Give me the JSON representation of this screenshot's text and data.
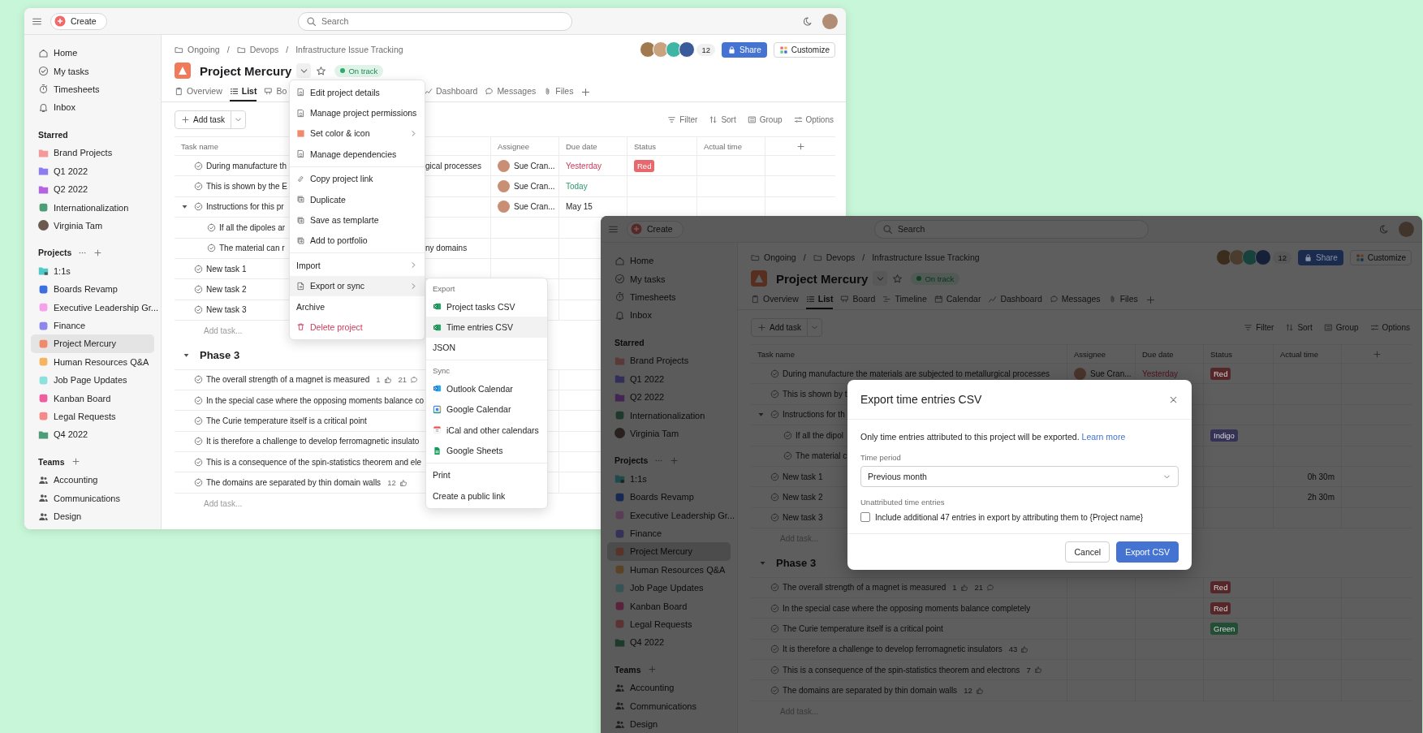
{
  "windows": [
    {
      "dimmed": false,
      "topbar": {
        "create": "Create",
        "search_placeholder": "Search"
      },
      "sidebar": {
        "nav": [
          {
            "label": "Home",
            "selected": false
          },
          {
            "label": "My tasks",
            "selected": false
          },
          {
            "label": "Timesheets",
            "selected": false
          },
          {
            "label": "Inbox",
            "selected": false
          }
        ],
        "sections": [
          {
            "title": "Starred",
            "items": [
              {
                "label": "Brand Projects",
                "kind": "folder",
                "color": "#f59a9a",
                "selected": false
              },
              {
                "label": "Q1 2022",
                "kind": "folder",
                "color": "#8b7cf0",
                "selected": false
              },
              {
                "label": "Q2 2022",
                "kind": "folder",
                "color": "#b563e0",
                "selected": false
              },
              {
                "label": "Internationalization",
                "kind": "project",
                "color": "#4e9d78",
                "selected": false
              },
              {
                "label": "Virginia Tam",
                "kind": "person",
                "selected": false
              }
            ]
          },
          {
            "title": "Projects",
            "more_button": true,
            "add_button": true,
            "items": [
              {
                "label": "1:1s",
                "kind": "locked-folder",
                "color": "#4fc9c9",
                "selected": false
              },
              {
                "label": "Boards Revamp",
                "kind": "project",
                "color": "#3d6fe0",
                "selected": false
              },
              {
                "label": "Executive Leadership Gr...",
                "kind": "project",
                "color": "#f5a3e8",
                "selected": false
              },
              {
                "label": "Finance",
                "kind": "project",
                "color": "#8e86ef",
                "selected": false
              },
              {
                "label": "Project Mercury",
                "kind": "project",
                "color": "#ef8a6a",
                "selected": true
              },
              {
                "label": "Human Resources Q&A",
                "kind": "project",
                "color": "#f4b460",
                "selected": false
              },
              {
                "label": "Job Page Updates",
                "kind": "project",
                "color": "#8de0de",
                "selected": false
              },
              {
                "label": "Kanban Board",
                "kind": "project",
                "color": "#ee5ea0",
                "selected": false
              },
              {
                "label": "Legal Requests",
                "kind": "project",
                "color": "#f58a8a",
                "selected": false
              },
              {
                "label": "Q4 2022",
                "kind": "folder",
                "color": "#4e9d78",
                "selected": false
              }
            ]
          },
          {
            "title": "Teams",
            "add_button": true,
            "items": [
              {
                "label": "Accounting",
                "kind": "team",
                "selected": false
              },
              {
                "label": "Communications",
                "kind": "team",
                "selected": false
              },
              {
                "label": "Design",
                "kind": "team",
                "selected": false
              }
            ]
          }
        ]
      },
      "breadcrumb": [
        {
          "label": "Ongoing",
          "kind": "folder"
        },
        {
          "label": "/",
          "kind": "separator"
        },
        {
          "label": "Devops",
          "kind": "folder"
        },
        {
          "label": "/",
          "kind": "separator"
        },
        {
          "label": "Infrastructure Issue Tracking",
          "kind": "page"
        }
      ],
      "project": {
        "name": "Project Mercury",
        "status": "On track",
        "members_count": "12",
        "share": "Share",
        "customize": "Customize"
      },
      "tabs": [
        {
          "label": "Overview",
          "kind": "overview",
          "selected": false
        },
        {
          "label": "List",
          "kind": "list",
          "selected": true
        },
        {
          "label": "Bo",
          "kind": "board",
          "selected": false
        }
      ],
      "tabs_after_menu": [
        {
          "label": "Dashboard",
          "kind": "dashboard",
          "selected": false
        },
        {
          "label": "Messages",
          "kind": "message",
          "selected": false
        },
        {
          "label": "Files",
          "kind": "clip",
          "selected": false
        }
      ],
      "add_task": "Add task",
      "toolbar": [
        {
          "label": "Filter",
          "kind": "filter"
        },
        {
          "label": "Sort",
          "kind": "sort"
        },
        {
          "label": "Group",
          "kind": "group"
        },
        {
          "label": "Options",
          "kind": "options"
        }
      ],
      "table": {
        "columns": [
          "Task name",
          "Assignee",
          "Due date",
          "Status",
          "Actual time"
        ],
        "rows": [
          {
            "name": "During manufacture th",
            "tail": "gical processes",
            "assignee": "Sue Cran...",
            "due": "Yesterday",
            "overdue": true,
            "status": {
              "label": "Red",
              "color": "#e8696d"
            }
          },
          {
            "name": "This is shown by the E",
            "assignee": "Sue Cran...",
            "due": "Today",
            "due_today": true
          },
          {
            "name": "Instructions for this pr",
            "assignee": "Sue Cran...",
            "due": "May 15",
            "expanded": true,
            "children": [
              {
                "name": "If all the dipoles ar"
              },
              {
                "name": "The material can r",
                "tail": "ny domains"
              }
            ]
          },
          {
            "name": "New task 1"
          },
          {
            "name": "New task 2"
          },
          {
            "name": "New task 3"
          }
        ],
        "add_task": "Add task...",
        "sections": [
          {
            "title": "Phase 3",
            "expanded": true,
            "rows": [
              {
                "name": "The overall strength of a magnet is measured",
                "likes": "1",
                "comments": "21"
              },
              {
                "name": "In the special case where the opposing moments balance co"
              },
              {
                "name": "The Curie temperature itself is a critical point"
              },
              {
                "name": "It is therefore a challenge to develop ferromagnetic insulato"
              },
              {
                "name": "This is a consequence of the spin-statistics theorem and ele"
              },
              {
                "name": "The domains are separated by thin domain walls",
                "likes": "12"
              }
            ],
            "add_task": "Add task..."
          }
        ]
      },
      "project_menu": {
        "sections": [
          {
            "items": [
              {
                "label": "Edit project details",
                "kind": "doc",
                "submenu": false,
                "selected": false
              },
              {
                "label": "Manage project permissions",
                "kind": "doc",
                "submenu": false,
                "selected": false
              },
              {
                "label": "Set color & icon",
                "kind": "swatch",
                "submenu": true,
                "selected": false
              },
              {
                "label": "Manage dependencies",
                "kind": "doc",
                "submenu": false,
                "selected": false
              }
            ]
          },
          {
            "items": [
              {
                "label": "Copy project link",
                "kind": "link",
                "submenu": false,
                "selected": false
              },
              {
                "label": "Duplicate",
                "kind": "copy",
                "submenu": false,
                "selected": false
              },
              {
                "label": "Save as templarte",
                "kind": "copy",
                "submenu": false,
                "selected": false
              },
              {
                "label": "Add to portfolio",
                "kind": "copy",
                "submenu": false,
                "selected": false
              }
            ]
          },
          {
            "items": [
              {
                "label": "Import",
                "kind": "plain",
                "submenu": true,
                "selected": false
              },
              {
                "label": "Export or sync",
                "kind": "export",
                "submenu": true,
                "selected": true
              },
              {
                "label": "Archive",
                "kind": "plain",
                "submenu": false,
                "selected": false
              },
              {
                "label": "Delete project",
                "kind": "delete",
                "submenu": false,
                "selected": false
              }
            ]
          }
        ]
      },
      "export_menu": {
        "sections": [
          {
            "heading": "Export",
            "items": [
              {
                "label": "Project tasks CSV",
                "kind": "excel",
                "selected": false
              },
              {
                "label": "Time entries CSV",
                "kind": "excel",
                "selected": true
              },
              {
                "label": "JSON",
                "kind": "plain",
                "selected": false
              }
            ]
          },
          {
            "heading": "Sync",
            "items": [
              {
                "label": "Outlook Calendar",
                "kind": "outlook",
                "selected": false
              },
              {
                "label": "Google Calendar",
                "kind": "gcal",
                "selected": false
              },
              {
                "label": "iCal and other calendars",
                "kind": "ical",
                "selected": false
              },
              {
                "label": "Google Sheets",
                "kind": "gsheets",
                "selected": false
              }
            ]
          },
          {
            "items": [
              {
                "label": "Print",
                "kind": "plain",
                "selected": false
              },
              {
                "label": "Create a public link",
                "kind": "plain",
                "selected": false
              }
            ]
          }
        ]
      }
    },
    {
      "dimmed": true,
      "topbar": {
        "create": "Create",
        "search_placeholder": "Search"
      },
      "sidebar": {
        "nav": [
          {
            "label": "Home",
            "selected": false
          },
          {
            "label": "My tasks",
            "selected": false
          },
          {
            "label": "Timesheets",
            "selected": false
          },
          {
            "label": "Inbox",
            "selected": false
          }
        ],
        "sections": [
          {
            "title": "Starred",
            "items": [
              {
                "label": "Brand Projects",
                "kind": "folder",
                "color": "#5b3939",
                "selected": false
              },
              {
                "label": "Q1 2022",
                "kind": "folder",
                "color": "#332e59",
                "selected": false
              },
              {
                "label": "Q2 2022",
                "kind": "folder",
                "color": "#432553",
                "selected": false
              },
              {
                "label": "Internationalization",
                "kind": "project",
                "color": "#1d3a2c",
                "selected": false
              },
              {
                "label": "Virginia Tam",
                "kind": "person",
                "selected": false
              }
            ]
          },
          {
            "title": "Projects",
            "more_button": true,
            "add_button": true,
            "items": [
              {
                "label": "1:1s",
                "kind": "locked-folder",
                "color": "#1d4a4a",
                "selected": false
              },
              {
                "label": "Boards Revamp",
                "kind": "project",
                "color": "#172953",
                "selected": false
              },
              {
                "label": "Executive Leadership Gr...",
                "kind": "project",
                "color": "#5b3c56",
                "selected": false
              },
              {
                "label": "Finance",
                "kind": "project",
                "color": "#353258",
                "selected": false
              },
              {
                "label": "Project Mercury",
                "kind": "project",
                "color": "#583327",
                "selected": true
              },
              {
                "label": "Human Resources Q&A",
                "kind": "project",
                "color": "#5a4324",
                "selected": false
              },
              {
                "label": "Job Page Updates",
                "kind": "project",
                "color": "#345352",
                "selected": false
              },
              {
                "label": "Kanban Board",
                "kind": "project",
                "color": "#58233b",
                "selected": false
              },
              {
                "label": "Legal Requests",
                "kind": "project",
                "color": "#5b3333",
                "selected": false
              },
              {
                "label": "Q4 2022",
                "kind": "folder",
                "color": "#1d3a2c",
                "selected": false
              }
            ]
          },
          {
            "title": "Teams",
            "add_button": true,
            "items": [
              {
                "label": "Accounting",
                "kind": "team",
                "selected": false
              },
              {
                "label": "Communications",
                "kind": "team",
                "selected": false
              },
              {
                "label": "Design",
                "kind": "team",
                "selected": false
              }
            ]
          }
        ]
      },
      "breadcrumb": [
        {
          "label": "Ongoing",
          "kind": "folder"
        },
        {
          "label": "/",
          "kind": "separator"
        },
        {
          "label": "Devops",
          "kind": "folder"
        },
        {
          "label": "/",
          "kind": "separator"
        },
        {
          "label": "Infrastructure Issue Tracking",
          "kind": "page"
        }
      ],
      "project": {
        "name": "Project Mercury",
        "status": "On track",
        "members_count": "12",
        "share": "Share",
        "customize": "Customize"
      },
      "tabs": [
        {
          "label": "Overview",
          "kind": "overview",
          "selected": false
        },
        {
          "label": "List",
          "kind": "list",
          "selected": true
        },
        {
          "label": "Board",
          "kind": "board",
          "selected": false
        },
        {
          "label": "Timeline",
          "kind": "timeline",
          "selected": false
        },
        {
          "label": "Calendar",
          "kind": "calendar",
          "selected": false
        },
        {
          "label": "Dashboard",
          "kind": "dashboard",
          "selected": false
        },
        {
          "label": "Messages",
          "kind": "message",
          "selected": false
        },
        {
          "label": "Files",
          "kind": "clip",
          "selected": false
        }
      ],
      "add_task": "Add task",
      "toolbar": [
        {
          "label": "Filter",
          "kind": "filter"
        },
        {
          "label": "Sort",
          "kind": "sort"
        },
        {
          "label": "Group",
          "kind": "group"
        },
        {
          "label": "Options",
          "kind": "options"
        }
      ],
      "table": {
        "columns": [
          "Task name",
          "Assignee",
          "Due date",
          "Status",
          "Actual time"
        ],
        "rows": [
          {
            "name": "During manufacture the materials are subjected to metallurgical processes",
            "assignee": "Sue Cran...",
            "due": "Yesterday",
            "overdue": true,
            "status": {
              "label": "Red",
              "color": "#562728"
            }
          },
          {
            "name": "This is shown by t"
          },
          {
            "name": "Instructions for th",
            "expanded": true,
            "children": [
              {
                "name": "If all the dipol",
                "status": {
                  "label": "Indigo",
                  "color": "#353355"
                }
              },
              {
                "name": "The material c"
              }
            ]
          },
          {
            "name": "New task 1",
            "actual_time": "0h 30m"
          },
          {
            "name": "New task 2",
            "actual_time": "2h 30m"
          },
          {
            "name": "New task 3"
          }
        ],
        "add_task": "Add task...",
        "sections": [
          {
            "title": "Phase 3",
            "expanded": true,
            "rows": [
              {
                "name": "The overall strength of a magnet is measured",
                "likes": "1",
                "comments": "21",
                "status": {
                  "label": "Red",
                  "color": "#562728"
                }
              },
              {
                "name": "In the special case where the opposing moments balance completely",
                "status": {
                  "label": "Red",
                  "color": "#562728"
                }
              },
              {
                "name": "The Curie temperature itself is a critical point",
                "status": {
                  "label": "Green",
                  "color": "#234d34"
                }
              },
              {
                "name": "It is therefore a challenge to develop ferromagnetic insulators",
                "likes": "43"
              },
              {
                "name": "This is a consequence of the spin-statistics theorem and electrons",
                "likes": "7"
              },
              {
                "name": "The domains are separated by thin domain walls",
                "likes": "12"
              }
            ],
            "add_task": "Add task..."
          }
        ]
      },
      "dialog": {
        "title": "Export time entries CSV",
        "message": "Only time entries attributed to this project will be exported.",
        "link": "Learn more",
        "select": {
          "label": "Time period",
          "value": "Previous month"
        },
        "option_label": "Unattributed time entries",
        "option": {
          "label": "Include additional 47 entries in export by attributing them to {Project name}",
          "checked": false
        },
        "buttons": [
          {
            "label": "Cancel",
            "kind": "secondary"
          },
          {
            "label": "Export CSV",
            "kind": "primary"
          }
        ]
      }
    }
  ]
}
